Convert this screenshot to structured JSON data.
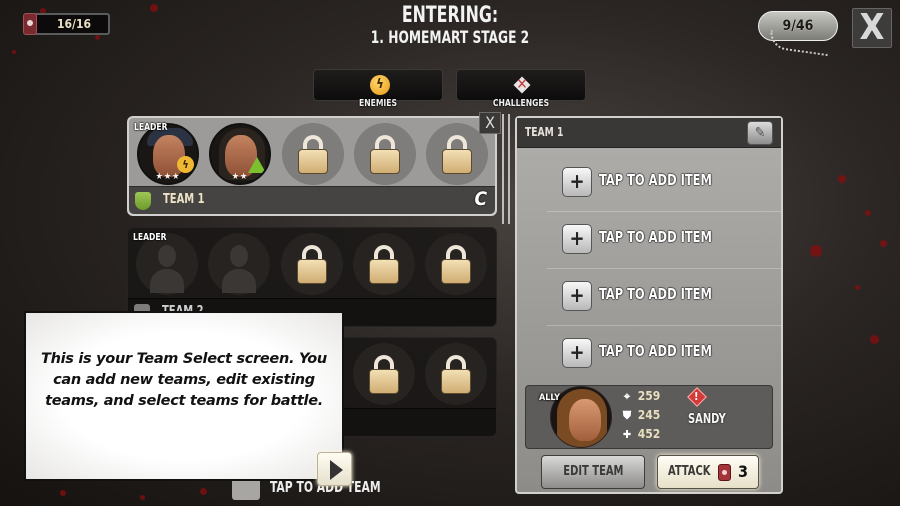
{
  "header": {
    "energy": "16/16",
    "entering_label": "ENTERING:",
    "stage_name": "1. HOMEMART STAGE 2",
    "progress_tag": "9/46",
    "close_label": "X"
  },
  "top_buttons": [
    {
      "label": "ENEMIES",
      "icon": "lightning-icon",
      "icon_glyph": "ϟ"
    },
    {
      "label": "CHALLENGES",
      "icon": "challenge-icon"
    }
  ],
  "teams": [
    {
      "name": "TEAM 1",
      "leader_label": "LEADER",
      "tier": "C",
      "selected": true,
      "shield_color": "#8fbf45",
      "remove_label": "X",
      "slots": [
        {
          "type": "hero",
          "stars": "★★★",
          "trait": "fast"
        },
        {
          "type": "hero",
          "stars": "★★",
          "trait": "tough"
        },
        {
          "type": "locked"
        },
        {
          "type": "locked"
        },
        {
          "type": "locked"
        }
      ]
    },
    {
      "name": "TEAM 2",
      "leader_label": "LEADER",
      "selected": false,
      "slots": [
        {
          "type": "empty"
        },
        {
          "type": "empty"
        },
        {
          "type": "locked"
        },
        {
          "type": "locked"
        },
        {
          "type": "locked"
        }
      ]
    },
    {
      "name": "",
      "selected": false,
      "slots": [
        {
          "type": "locked"
        },
        {
          "type": "locked"
        }
      ]
    }
  ],
  "add_team_label": "TAP TO ADD TEAM",
  "tutorial": {
    "text": "This is your Team Select screen. You can add new teams, edit existing teams, and select teams for battle.",
    "next_icon": "play-arrow-icon"
  },
  "panel": {
    "title": "TEAM 1",
    "edit_icon": "pencil-icon",
    "edit_glyph": "✎",
    "items": [
      {
        "label": "TAP TO ADD ITEM"
      },
      {
        "label": "TAP TO ADD ITEM"
      },
      {
        "label": "TAP TO ADD ITEM"
      },
      {
        "label": "TAP TO ADD ITEM"
      }
    ],
    "plus_glyph": "+",
    "ally": {
      "tag": "ALLY",
      "attack": "259",
      "defense": "245",
      "health": "452",
      "alert_glyph": "!",
      "name": "SANDY"
    },
    "edit_team_label": "EDIT TEAM",
    "attack_label": "ATTACK",
    "attack_cost": "3"
  },
  "colors": {
    "accent_gold": "#e9dfc4",
    "alert_red": "#d33b3b",
    "team_shield_green": "#8fbf45"
  }
}
